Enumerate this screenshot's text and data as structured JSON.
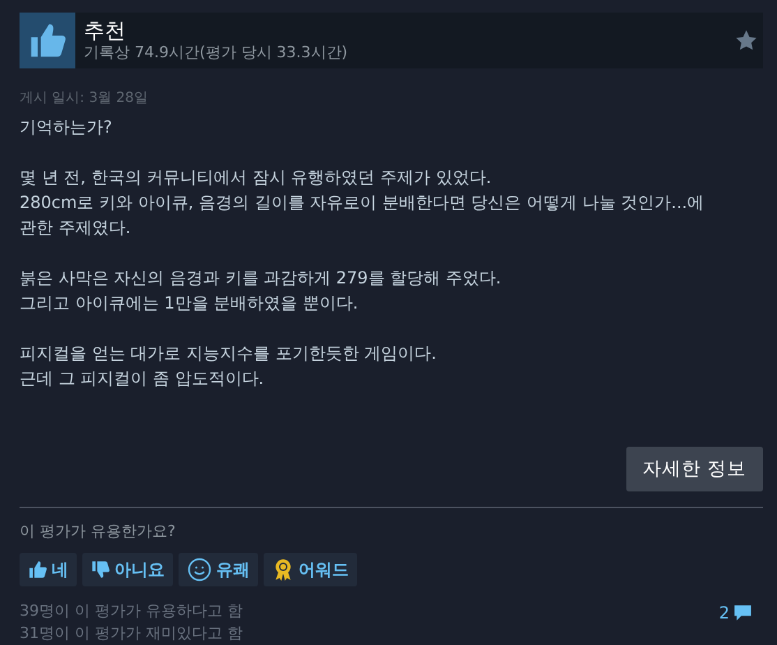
{
  "header": {
    "title": "추천",
    "playtime": "기록상 74.9시간(평가 당시 33.3시간)"
  },
  "posted": "게시 일시: 3월 28일",
  "paragraphs": [
    [
      "기억하는가?"
    ],
    [
      "몇 년 전, 한국의 커뮤니티에서 잠시 유행하였던 주제가 있었다.",
      "280cm로 키와 아이큐, 음경의 길이를 자유로이 분배한다면 당신은 어떻게 나눌 것인가...에",
      "관한 주제였다."
    ],
    [
      "붉은 사막은 자신의 음경과 키를 과감하게 279를 할당해 주었다.",
      "그리고 아이큐에는 1만을 분배하였을 뿐이다."
    ],
    [
      "피지컬을 얻는 대가로 지능지수를 포기한듯한 게임이다.",
      "근데 그 피지컬이 좀 압도적이다."
    ]
  ],
  "more_button": "자세한 정보",
  "question": "이 평가가 유용한가요?",
  "votes": [
    {
      "kind": "yes",
      "label": "네"
    },
    {
      "kind": "no",
      "label": "아니요"
    },
    {
      "kind": "funny",
      "label": "유쾌"
    },
    {
      "kind": "award",
      "label": "어워드"
    }
  ],
  "stats": [
    "39명이 이 평가가 유용하다고 함",
    "31명이 이 평가가 재미있다고 함"
  ],
  "comments": "2"
}
